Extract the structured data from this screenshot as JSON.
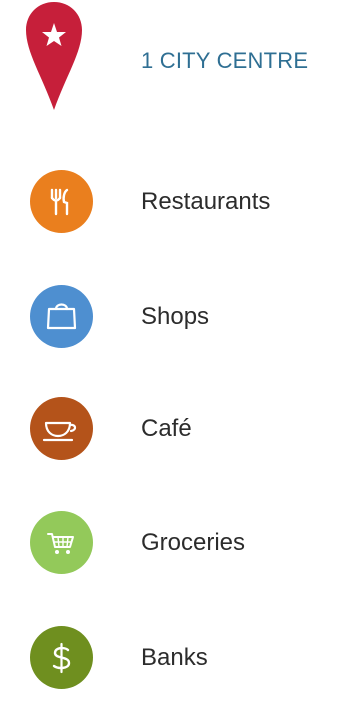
{
  "header": {
    "title": "1 CITY CENTRE",
    "pin_color": "#c61f3a",
    "pin_icon": "star-icon"
  },
  "legend": {
    "items": [
      {
        "id": "restaurants",
        "label": "Restaurants",
        "color": "#ea7f1e",
        "icon": "fork-knife-icon"
      },
      {
        "id": "shops",
        "label": "Shops",
        "color": "#4e8fd0",
        "icon": "shopping-bag-icon"
      },
      {
        "id": "cafe",
        "label": "Café",
        "color": "#b4531a",
        "icon": "coffee-cup-icon"
      },
      {
        "id": "groceries",
        "label": "Groceries",
        "color": "#93c95a",
        "icon": "shopping-cart-icon"
      },
      {
        "id": "banks",
        "label": "Banks",
        "color": "#6f8f1f",
        "icon": "dollar-sign-icon"
      }
    ]
  }
}
